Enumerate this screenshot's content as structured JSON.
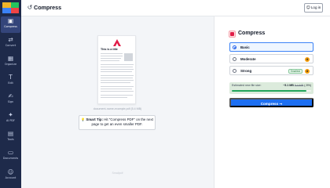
{
  "app": {
    "logo_colors": [
      "#f0b429",
      "#22c55e",
      "#3b82f6",
      "#ef4444"
    ]
  },
  "sidebar": {
    "items": [
      {
        "label": "Compress",
        "icon": "compress-icon",
        "glyph": "▣",
        "active": true
      },
      {
        "label": "Convert",
        "icon": "convert-icon",
        "glyph": "⇄",
        "active": false
      },
      {
        "label": "Organize",
        "icon": "organize-icon",
        "glyph": "▦",
        "active": false
      },
      {
        "label": "Edit",
        "icon": "text-edit-icon",
        "glyph": "T",
        "active": false
      },
      {
        "label": "Sign",
        "icon": "signature-icon",
        "glyph": "✍",
        "active": false
      },
      {
        "label": "AI PDF",
        "icon": "ai-sparkle-icon",
        "glyph": "✦",
        "active": false
      },
      {
        "label": "Tools",
        "icon": "tools-grid-icon",
        "glyph": "▤",
        "active": false
      },
      {
        "label": "Documents",
        "icon": "folder-icon",
        "glyph": "▭",
        "active": false
      }
    ],
    "account": {
      "label": "Account",
      "icon": "user-icon",
      "glyph": "☺"
    }
  },
  "header": {
    "title": "Compress",
    "icon": "history-icon",
    "icon_glyph": "↺",
    "login_label": "Log in",
    "login_glyph": "☺"
  },
  "preview": {
    "doc_title": "This is a title",
    "caption": "document-name-example.pdf (5.4 MB)",
    "tip_bold": "Smart Tip:",
    "tip_text": "Hit \"Compress PDF\" on the next page to get an even smaller PDF.",
    "tip_icon": "lightbulb-icon",
    "tip_glyph": "💡",
    "watermark": "Smallpdf"
  },
  "panel": {
    "title": "Compress",
    "accent": "#e11d48",
    "options": [
      {
        "label": "Basic",
        "selected": true,
        "pro": false,
        "badge": ""
      },
      {
        "label": "Moderate",
        "selected": false,
        "pro": true,
        "badge": ""
      },
      {
        "label": "Strong",
        "selected": false,
        "pro": true,
        "badge": "Smallest"
      }
    ],
    "crown_glyph": "♛",
    "estimate": {
      "label": "Estimated new file size:",
      "new_size": "~5.1 MB",
      "old_size": "5.4 MB",
      "change": "(-5%)",
      "progress": 0.94
    },
    "compress_label": "Compress",
    "compress_arrow": "→",
    "button_color": "#1d6ff2"
  }
}
